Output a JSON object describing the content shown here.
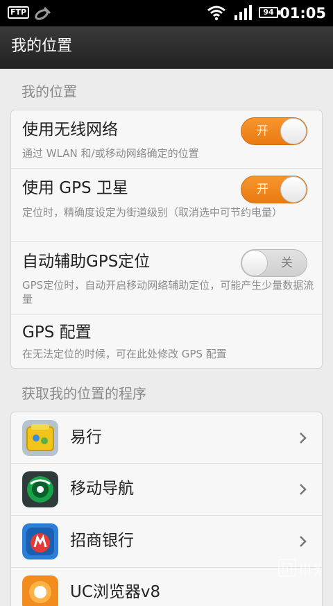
{
  "status_bar": {
    "ftp_label": "FTP",
    "battery_level": "94",
    "time": "01:05"
  },
  "header": {
    "title": "我的位置"
  },
  "sections": {
    "location_header": "我的位置",
    "apps_header": "获取我的位置的程序"
  },
  "settings": [
    {
      "title": "使用无线网络",
      "subtitle": "通过 WLAN 和/或移动网络确定的位置",
      "toggle_label": "开",
      "toggle_state": "on"
    },
    {
      "title": "使用 GPS 卫星",
      "subtitle": "定位时，精确度设定为街道级别（取消选中可节约电量）",
      "toggle_label": "开",
      "toggle_state": "on"
    },
    {
      "title": "自动辅助GPS定位",
      "subtitle": "GPS定位时，自动开启移动网络辅助定位，可能产生少量数据流量",
      "toggle_label": "关",
      "toggle_state": "off"
    },
    {
      "title": "GPS 配置",
      "subtitle": "在无法定位的时候，可在此处修改 GPS 配置"
    }
  ],
  "apps": [
    {
      "name": "易行",
      "icon": "yixing-app-icon"
    },
    {
      "name": "移动导航",
      "icon": "mobile-navigation-app-icon"
    },
    {
      "name": "招商银行",
      "icon": "cmb-bank-app-icon"
    },
    {
      "name": "UC浏览器v8",
      "icon": "uc-browser-app-icon"
    }
  ],
  "colors": {
    "accent": "#f28a1f",
    "title_bar": "#2e2e2e",
    "background": "#ececec"
  }
}
